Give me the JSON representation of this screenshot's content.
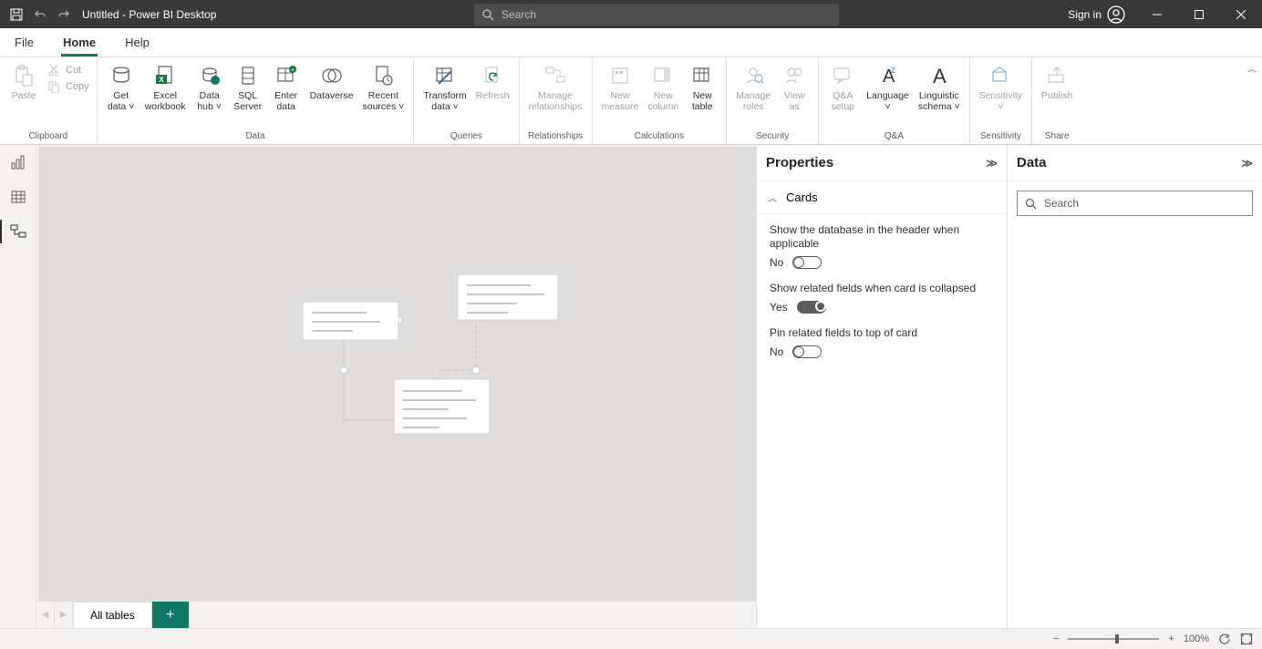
{
  "titlebar": {
    "title": "Untitled - Power BI Desktop",
    "search_placeholder": "Search",
    "signin": "Sign in"
  },
  "menu": {
    "file": "File",
    "home": "Home",
    "help": "Help"
  },
  "ribbon": {
    "paste": "Paste",
    "cut": "Cut",
    "copy": "Copy",
    "group_clipboard": "Clipboard",
    "get_data": "Get",
    "get_data2": "data",
    "excel": "Excel",
    "excel2": "workbook",
    "datahub": "Data",
    "datahub2": "hub",
    "sql": "SQL",
    "sql2": "Server",
    "enter": "Enter",
    "enter2": "data",
    "dataverse": "Dataverse",
    "recent": "Recent",
    "recent2": "sources",
    "group_data": "Data",
    "transform": "Transform",
    "transform2": "data",
    "refresh": "Refresh",
    "group_queries": "Queries",
    "manage_rel": "Manage",
    "manage_rel2": "relationships",
    "group_rel": "Relationships",
    "new_measure": "New",
    "new_measure2": "measure",
    "new_col": "New",
    "new_col2": "column",
    "new_table": "New",
    "new_table2": "table",
    "group_calc": "Calculations",
    "manage_roles": "Manage",
    "manage_roles2": "roles",
    "view_as": "View",
    "view_as2": "as",
    "group_security": "Security",
    "qa": "Q&A",
    "qa2": "setup",
    "lang": "Language",
    "ling": "Linguistic",
    "ling2": "schema",
    "group_qa": "Q&A",
    "sens": "Sensitivity",
    "group_sens": "Sensitivity",
    "publish": "Publish",
    "group_share": "Share"
  },
  "tabbar": {
    "all_tables": "All tables"
  },
  "properties": {
    "title": "Properties",
    "section": "Cards",
    "p1": "Show the database in the header when applicable",
    "p1v": "No",
    "p2": "Show related fields when card is collapsed",
    "p2v": "Yes",
    "p3": "Pin related fields to top of card",
    "p3v": "No"
  },
  "datapane": {
    "title": "Data",
    "search": "Search"
  },
  "status": {
    "zoom": "100%"
  }
}
